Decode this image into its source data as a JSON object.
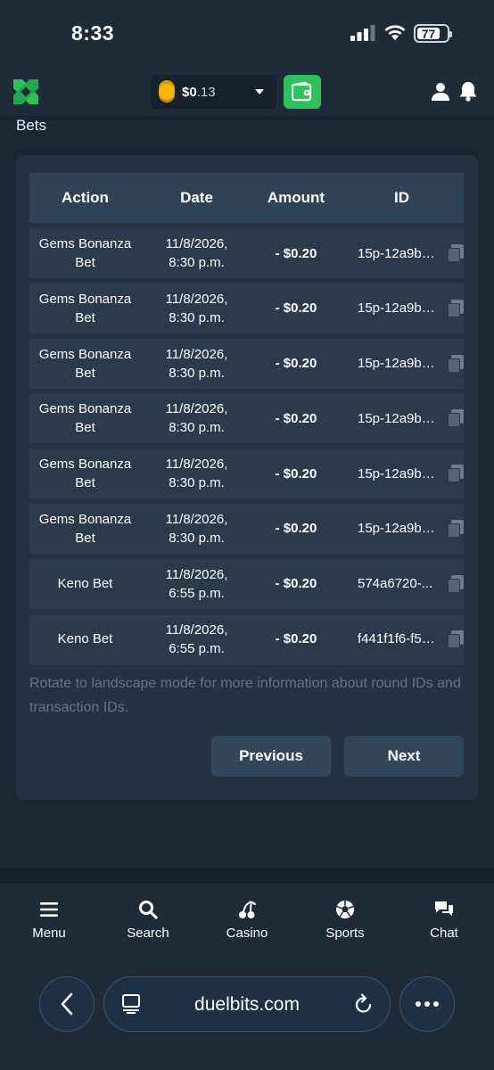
{
  "status_bar": {
    "time": "8:33",
    "battery": "77"
  },
  "header": {
    "balance": "$0",
    "balance_decimals": ".13"
  },
  "section_title": "Bets",
  "table": {
    "headers": [
      "Action",
      "Date",
      "Amount",
      "ID"
    ],
    "rows": [
      {
        "action_line1": "Gems Bonanza",
        "action_line2": "Bet",
        "date_line1": "11/8/2026,",
        "date_line2": "8:30 p.m.",
        "amount": "- $0.20",
        "id": "15p-12a9b2..."
      },
      {
        "action_line1": "Gems Bonanza",
        "action_line2": "Bet",
        "date_line1": "11/8/2026,",
        "date_line2": "8:30 p.m.",
        "amount": "- $0.20",
        "id": "15p-12a9b2..."
      },
      {
        "action_line1": "Gems Bonanza",
        "action_line2": "Bet",
        "date_line1": "11/8/2026,",
        "date_line2": "8:30 p.m.",
        "amount": "- $0.20",
        "id": "15p-12a9b2..."
      },
      {
        "action_line1": "Gems Bonanza",
        "action_line2": "Bet",
        "date_line1": "11/8/2026,",
        "date_line2": "8:30 p.m.",
        "amount": "- $0.20",
        "id": "15p-12a9b2..."
      },
      {
        "action_line1": "Gems Bonanza",
        "action_line2": "Bet",
        "date_line1": "11/8/2026,",
        "date_line2": "8:30 p.m.",
        "amount": "- $0.20",
        "id": "15p-12a9b2..."
      },
      {
        "action_line1": "Gems Bonanza",
        "action_line2": "Bet",
        "date_line1": "11/8/2026,",
        "date_line2": "8:30 p.m.",
        "amount": "- $0.20",
        "id": "15p-12a9b2..."
      },
      {
        "action_line1": "Keno Bet",
        "action_line2": "",
        "date_line1": "11/8/2026,",
        "date_line2": "6:55 p.m.",
        "amount": "- $0.20",
        "id": "574a6720-..."
      },
      {
        "action_line1": "Keno Bet",
        "action_line2": "",
        "date_line1": "11/8/2026,",
        "date_line2": "6:55 p.m.",
        "amount": "- $0.20",
        "id": "f441f1f6-f54..."
      }
    ]
  },
  "note": "Rotate to landscape mode for more information about round IDs and transaction IDs.",
  "pagination": {
    "previous": "Previous",
    "next": "Next"
  },
  "bottom_nav": {
    "items": [
      {
        "label": "Menu",
        "icon": "menu-icon"
      },
      {
        "label": "Search",
        "icon": "search-icon"
      },
      {
        "label": "Casino",
        "icon": "cherry-icon"
      },
      {
        "label": "Sports",
        "icon": "soccer-ball-icon"
      },
      {
        "label": "Chat",
        "icon": "chat-icon"
      }
    ]
  },
  "browser": {
    "url": "duelbits.com"
  },
  "colors": {
    "accent_green": "#2cc25a",
    "coin": "#f5b700",
    "background": "#1b2633",
    "card": "#243344"
  }
}
